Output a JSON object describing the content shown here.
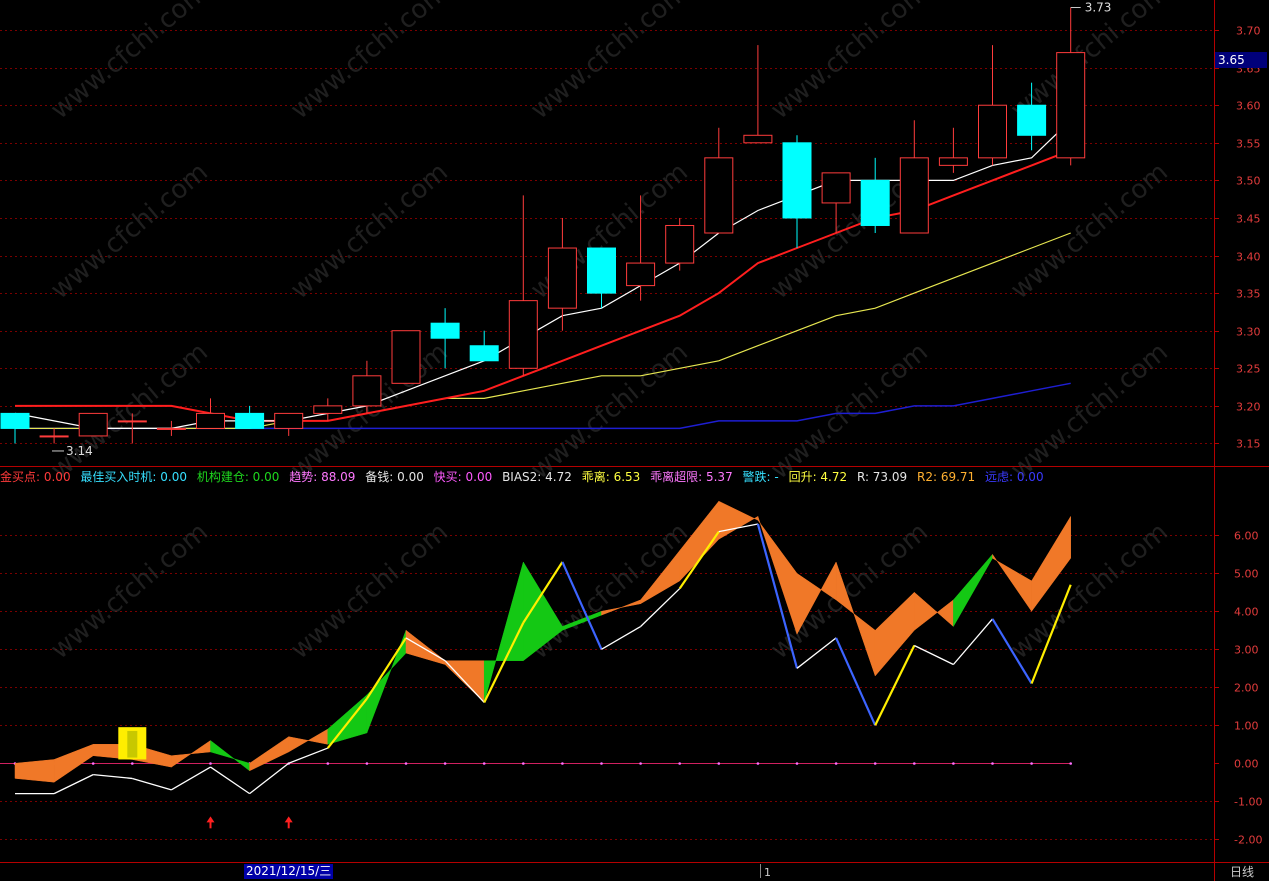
{
  "current_price": "3.65",
  "cursor_date": "2021/12/15/三",
  "period": "日线",
  "watermark": "www.cfchi.com",
  "legend": [
    "金买点: 0.00",
    "最佳买入时机: 0.00",
    "机构建仓: 0.00",
    "趋势: 88.09",
    "备钱: 0.00",
    "快买: 0.00",
    "BIAS2: 4.72",
    "乖离: 6.53",
    "乖离超限: 5.37",
    "警跌: -",
    "回升: 4.72",
    "R: 73.09",
    "R2: 69.71",
    "远虑: 0.00"
  ],
  "colors": {
    "up": "#ff3c3c",
    "down": "#00ffff",
    "ma_short": "#ffffff",
    "ma_mid": "#ff1e1e",
    "ma_long": "#e6e650",
    "ma_xlong": "#1e1ed2",
    "grid": "#7a0000",
    "axis": "#b40000",
    "orange": "#f07828",
    "green": "#14c814",
    "yellow": "#ffee00",
    "blue": "#3c64ff"
  },
  "chart_data": [
    {
      "type": "candlestick",
      "panel": "price",
      "ylim": [
        3.12,
        3.74
      ],
      "y_ticks": [
        "3.15",
        "3.20",
        "3.25",
        "3.30",
        "3.35",
        "3.40",
        "3.45",
        "3.50",
        "3.55",
        "3.60",
        "3.65",
        "3.70"
      ],
      "annotations": {
        "high": "3.73",
        "low": "3.14"
      },
      "candles": [
        {
          "o": 3.19,
          "h": 3.19,
          "l": 3.15,
          "c": 3.17
        },
        {
          "o": 3.16,
          "h": 3.17,
          "l": 3.15,
          "c": 3.16
        },
        {
          "o": 3.16,
          "h": 3.19,
          "l": 3.16,
          "c": 3.19
        },
        {
          "o": 3.18,
          "h": 3.19,
          "l": 3.15,
          "c": 3.18
        },
        {
          "o": 3.17,
          "h": 3.18,
          "l": 3.16,
          "c": 3.17
        },
        {
          "o": 3.17,
          "h": 3.21,
          "l": 3.17,
          "c": 3.19
        },
        {
          "o": 3.19,
          "h": 3.2,
          "l": 3.17,
          "c": 3.17
        },
        {
          "o": 3.17,
          "h": 3.19,
          "l": 3.16,
          "c": 3.19
        },
        {
          "o": 3.19,
          "h": 3.21,
          "l": 3.18,
          "c": 3.2
        },
        {
          "o": 3.2,
          "h": 3.26,
          "l": 3.19,
          "c": 3.24
        },
        {
          "o": 3.23,
          "h": 3.3,
          "l": 3.23,
          "c": 3.3
        },
        {
          "o": 3.31,
          "h": 3.33,
          "l": 3.25,
          "c": 3.29
        },
        {
          "o": 3.28,
          "h": 3.3,
          "l": 3.26,
          "c": 3.26
        },
        {
          "o": 3.25,
          "h": 3.48,
          "l": 3.24,
          "c": 3.34
        },
        {
          "o": 3.33,
          "h": 3.45,
          "l": 3.3,
          "c": 3.41
        },
        {
          "o": 3.41,
          "h": 3.41,
          "l": 3.33,
          "c": 3.35
        },
        {
          "o": 3.36,
          "h": 3.48,
          "l": 3.34,
          "c": 3.39
        },
        {
          "o": 3.39,
          "h": 3.45,
          "l": 3.38,
          "c": 3.44
        },
        {
          "o": 3.43,
          "h": 3.57,
          "l": 3.43,
          "c": 3.53
        },
        {
          "o": 3.55,
          "h": 3.68,
          "l": 3.55,
          "c": 3.56
        },
        {
          "o": 3.55,
          "h": 3.56,
          "l": 3.41,
          "c": 3.45
        },
        {
          "o": 3.47,
          "h": 3.51,
          "l": 3.43,
          "c": 3.51
        },
        {
          "o": 3.5,
          "h": 3.53,
          "l": 3.43,
          "c": 3.44
        },
        {
          "o": 3.43,
          "h": 3.58,
          "l": 3.43,
          "c": 3.53
        },
        {
          "o": 3.52,
          "h": 3.57,
          "l": 3.51,
          "c": 3.53
        },
        {
          "o": 3.53,
          "h": 3.68,
          "l": 3.52,
          "c": 3.6
        },
        {
          "o": 3.6,
          "h": 3.63,
          "l": 3.54,
          "c": 3.56
        },
        {
          "o": 3.53,
          "h": 3.73,
          "l": 3.52,
          "c": 3.67
        }
      ],
      "ma_short": [
        3.19,
        3.18,
        3.17,
        3.17,
        3.17,
        3.18,
        3.18,
        3.18,
        3.19,
        3.2,
        3.22,
        3.24,
        3.26,
        3.29,
        3.32,
        3.33,
        3.36,
        3.39,
        3.43,
        3.46,
        3.48,
        3.5,
        3.5,
        3.5,
        3.5,
        3.52,
        3.53,
        3.58
      ],
      "ma_mid": [
        3.2,
        3.2,
        3.2,
        3.2,
        3.2,
        3.19,
        3.18,
        3.18,
        3.18,
        3.19,
        3.2,
        3.21,
        3.22,
        3.24,
        3.26,
        3.28,
        3.3,
        3.32,
        3.35,
        3.39,
        3.41,
        3.43,
        3.45,
        3.46,
        3.48,
        3.5,
        3.52,
        3.54
      ],
      "ma_long": [
        3.17,
        3.17,
        3.17,
        3.17,
        3.17,
        3.17,
        3.17,
        3.18,
        3.18,
        3.19,
        3.2,
        3.21,
        3.21,
        3.22,
        3.23,
        3.24,
        3.24,
        3.25,
        3.26,
        3.28,
        3.3,
        3.32,
        3.33,
        3.35,
        3.37,
        3.39,
        3.41,
        3.43
      ],
      "ma_xlong": [
        3.17,
        3.17,
        3.17,
        3.17,
        3.17,
        3.17,
        3.17,
        3.17,
        3.17,
        3.17,
        3.17,
        3.17,
        3.17,
        3.17,
        3.17,
        3.17,
        3.17,
        3.17,
        3.18,
        3.18,
        3.18,
        3.19,
        3.19,
        3.2,
        3.2,
        3.21,
        3.22,
        3.23
      ]
    },
    {
      "type": "area",
      "panel": "indicator",
      "ylim": [
        -2.6,
        7.3
      ],
      "y_ticks": [
        "-2.00",
        "-1.00",
        "0.00",
        "1.00",
        "2.00",
        "3.00",
        "4.00",
        "5.00",
        "6.00"
      ],
      "x_labels": [
        "2021/12/15/三",
        "1"
      ],
      "series": [
        {
          "name": "乖离",
          "values": [
            0.0,
            0.1,
            0.5,
            0.5,
            0.2,
            0.3,
            0.0,
            0.7,
            0.5,
            0.8,
            3.5,
            2.7,
            2.7,
            2.7,
            3.5,
            3.9,
            4.3,
            5.6,
            6.9,
            6.4,
            5.0,
            4.3,
            3.5,
            4.5,
            3.6,
            5.4,
            4.8,
            6.5
          ]
        },
        {
          "name": "乖离超限",
          "values": [
            -0.4,
            -0.5,
            0.2,
            0.1,
            -0.1,
            0.6,
            -0.2,
            0.3,
            0.9,
            1.8,
            2.9,
            2.6,
            1.6,
            5.3,
            3.6,
            4.0,
            4.2,
            4.8,
            5.9,
            6.5,
            3.4,
            5.3,
            2.3,
            3.5,
            4.3,
            5.5,
            4.0,
            5.4
          ]
        },
        {
          "name": "BIAS2",
          "values": [
            -0.8,
            -0.8,
            -0.3,
            -0.4,
            -0.7,
            -0.1,
            -0.8,
            0.0,
            0.4,
            1.7,
            3.3,
            2.7,
            1.6,
            3.7,
            5.3,
            3.0,
            3.6,
            4.6,
            6.1,
            6.3,
            2.5,
            3.3,
            1.0,
            3.1,
            2.6,
            3.8,
            2.1,
            4.7
          ]
        }
      ],
      "markers": {
        "up_arrows_at": [
          5,
          7
        ],
        "yellow_box_at": 3
      }
    }
  ]
}
